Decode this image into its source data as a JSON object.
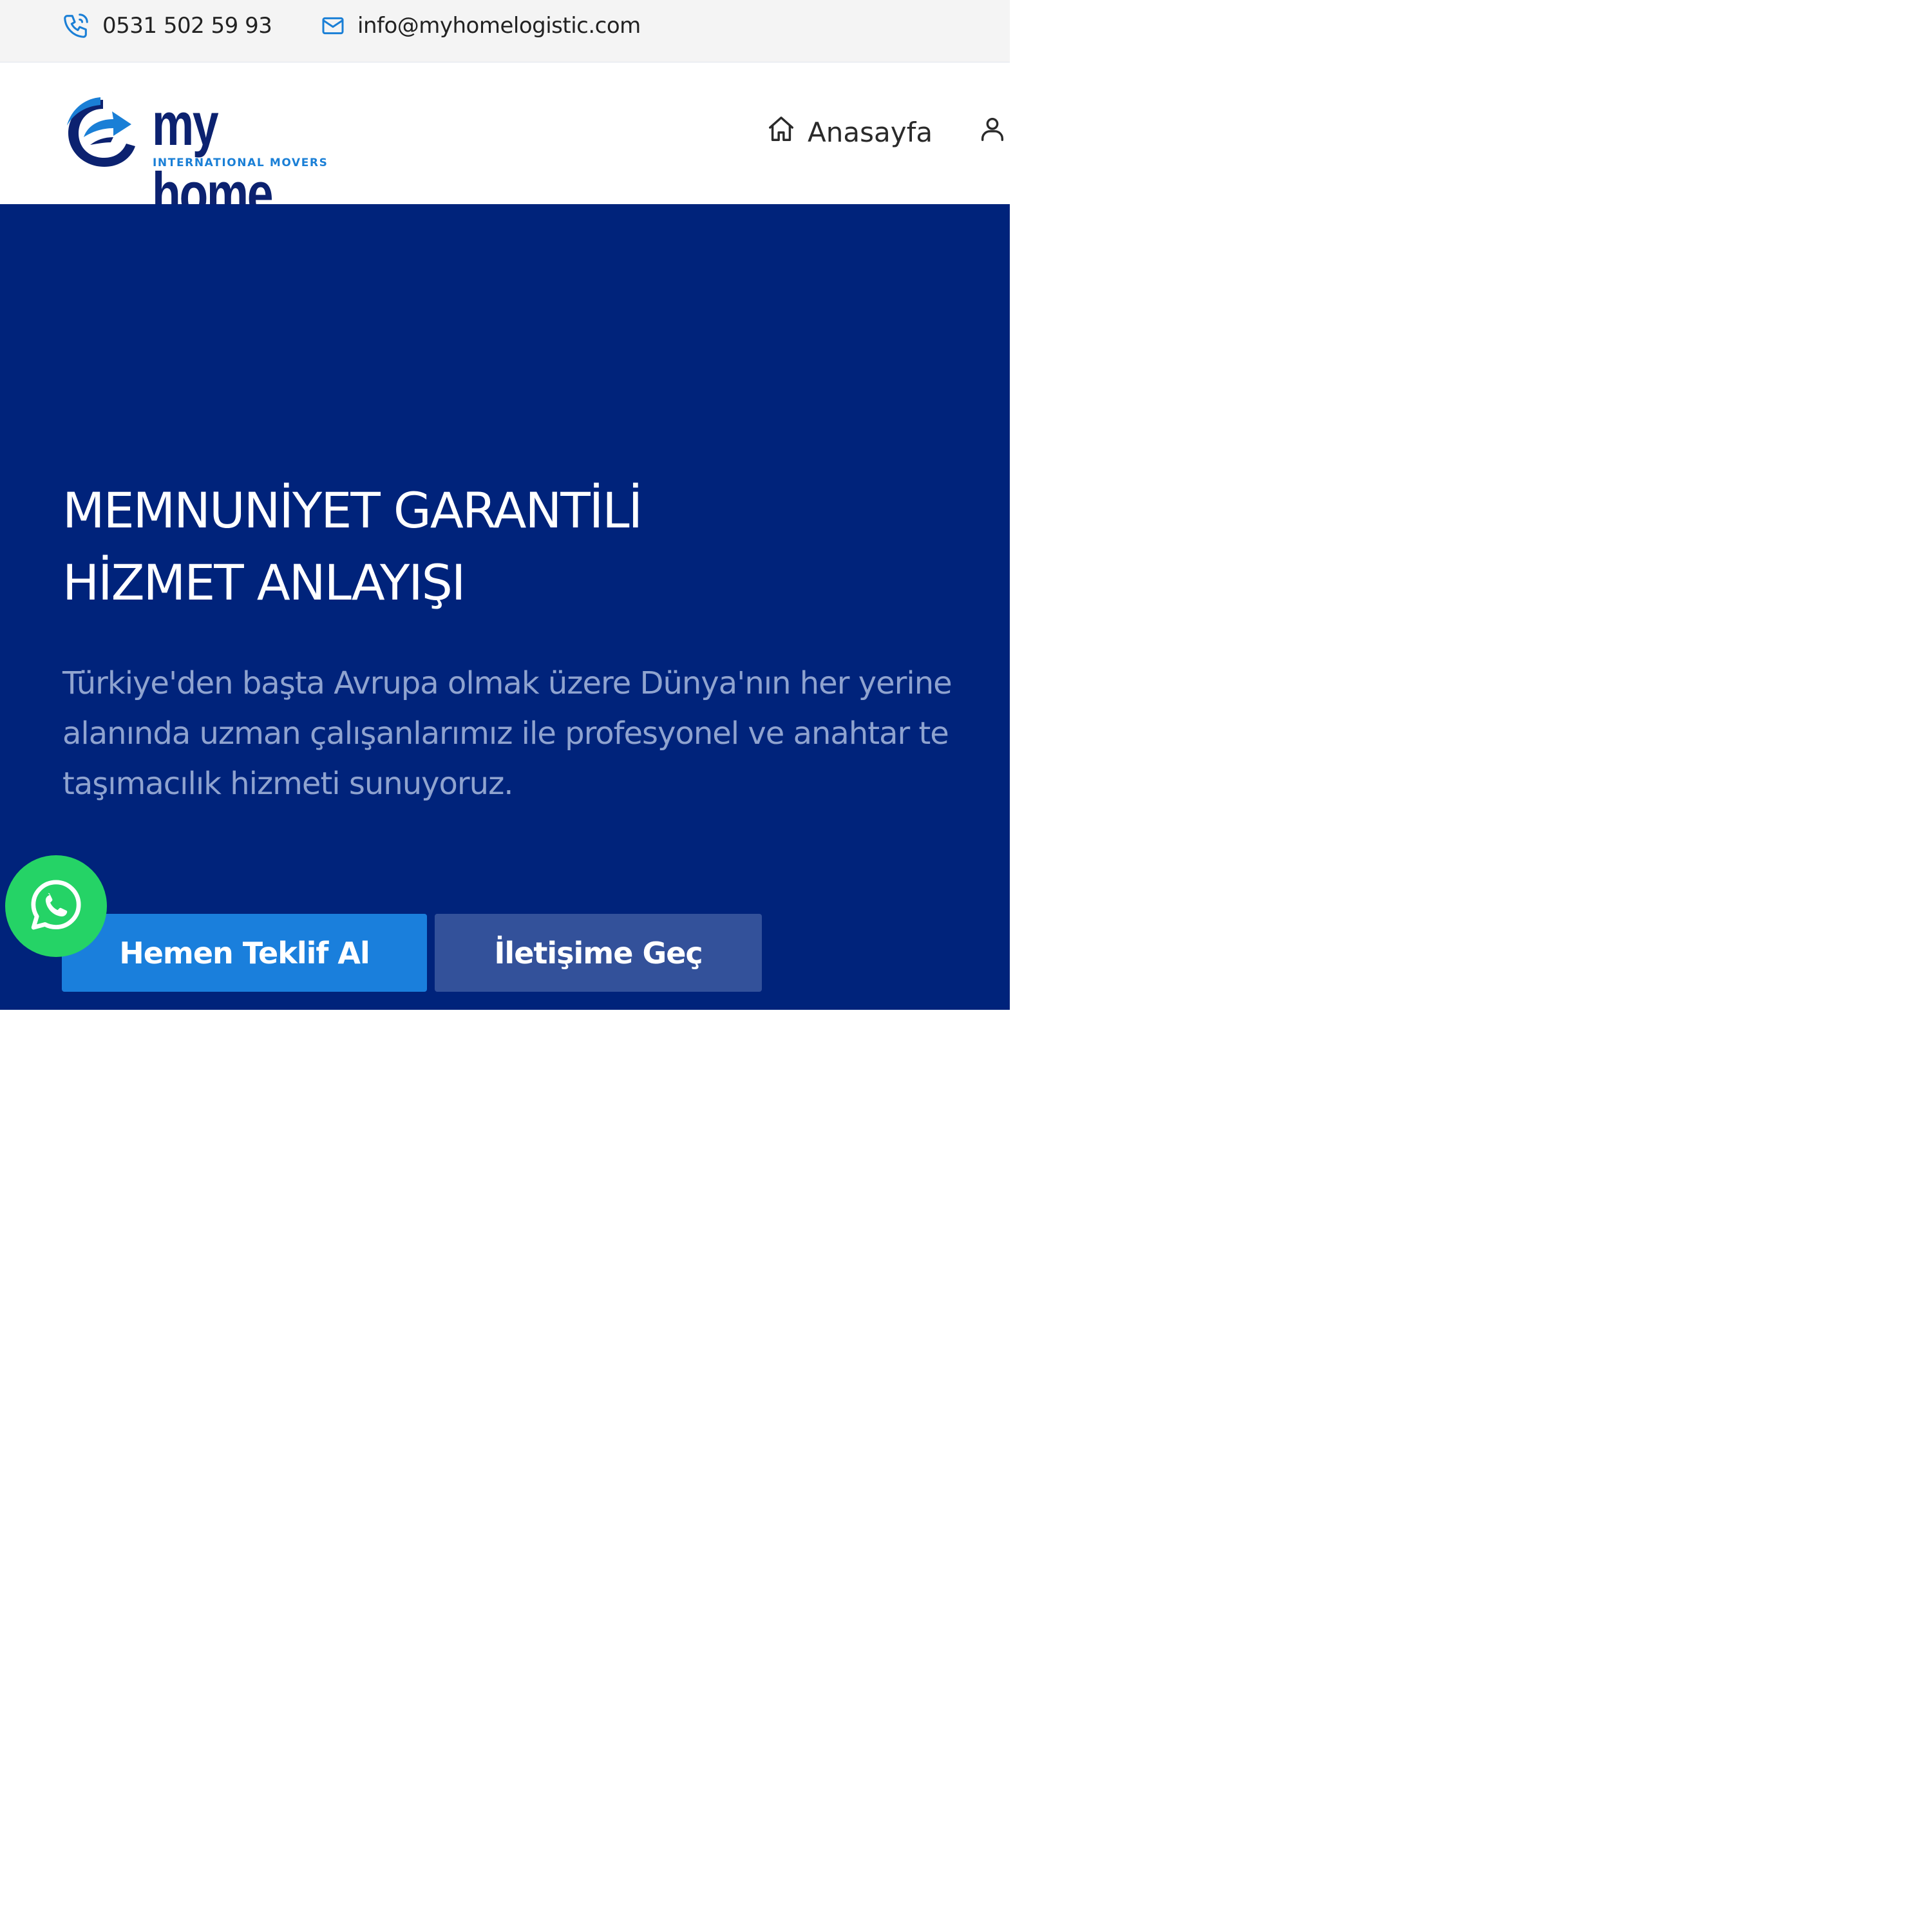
{
  "topbar": {
    "phone": "0531 502 59 93",
    "email": "info@myhomelogistic.com",
    "phone_icon": "phone-icon",
    "email_icon": "mail-icon"
  },
  "header": {
    "logo": {
      "word": "my home",
      "tagline": "INTERNATIONAL MOVERS"
    },
    "nav": [
      {
        "label": "Anasayfa",
        "icon": "home-icon"
      },
      {
        "label": "",
        "icon": "user-icon"
      }
    ]
  },
  "hero": {
    "title_lines": [
      "MEMNUNİYET GARANTİLİ",
      "HİZMET ANLAYIŞI"
    ],
    "text_lines": [
      "Türkiye'den başta Avrupa olmak üzere Dünya'nın her yerine",
      "alanında uzman çalışanlarımız ile profesyonel ve anahtar te",
      "taşımacılık hizmeti sunuyoruz."
    ],
    "primary_button": "Hemen Teklif Al",
    "secondary_button": "İletişime Geç"
  },
  "floating": {
    "icon": "whatsapp-icon"
  },
  "colors": {
    "hero_bg": "#00237b",
    "primary": "#1a7fdc",
    "secondary": "#33519a",
    "whatsapp": "#25d366",
    "brand_dark": "#0c2270"
  }
}
